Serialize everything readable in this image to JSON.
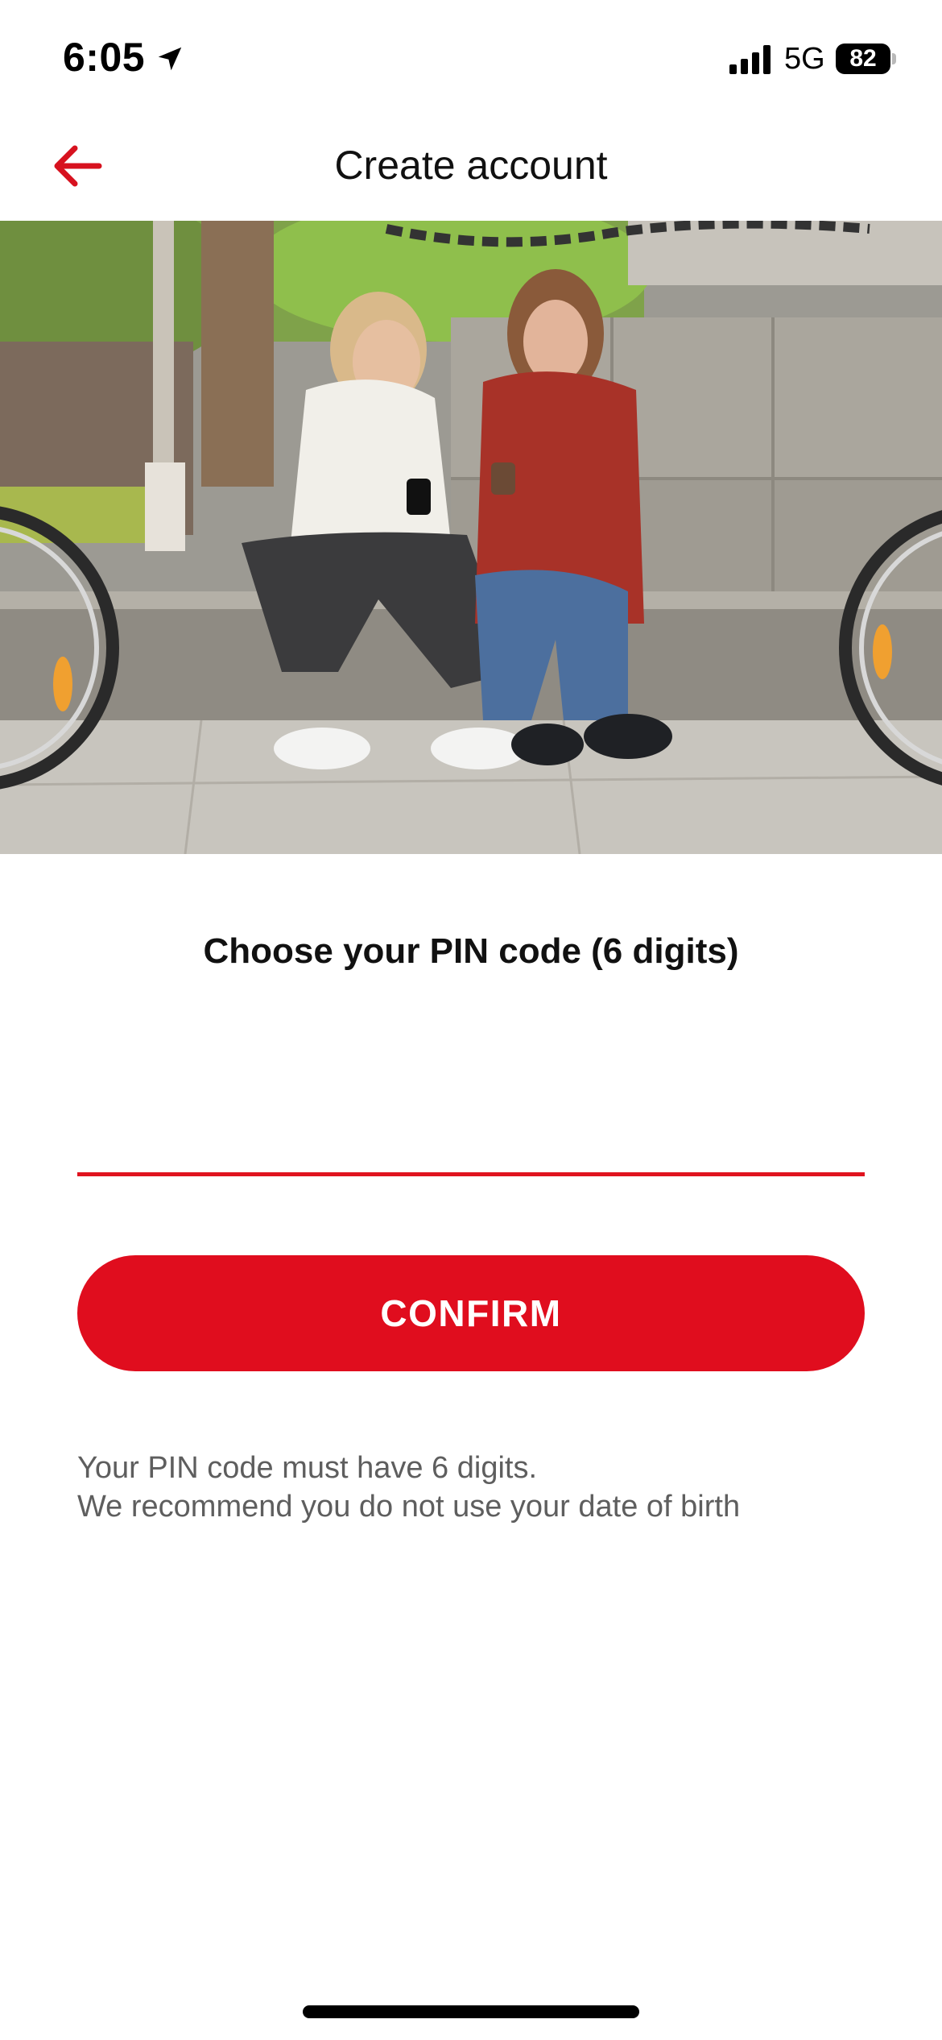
{
  "status_bar": {
    "time": "6:05",
    "network": "5G",
    "battery_level": "82",
    "icons": [
      "location-arrow-icon",
      "cellular-signal-icon",
      "battery-icon"
    ]
  },
  "header": {
    "title": "Create account",
    "back_icon": "arrow-left-icon"
  },
  "hero": {
    "description_icon": "photo"
  },
  "pin_form": {
    "heading": "Choose your PIN code (6 digits)",
    "input_value": "",
    "confirm_label": "CONFIRM",
    "hint_lines": [
      "Your PIN code must have 6 digits.",
      "We recommend you do not use your date of birth"
    ]
  },
  "colors": {
    "accent": "#e00d1e",
    "hint_text": "#5e5e5e",
    "title_text": "#111111",
    "background": "#ffffff"
  }
}
